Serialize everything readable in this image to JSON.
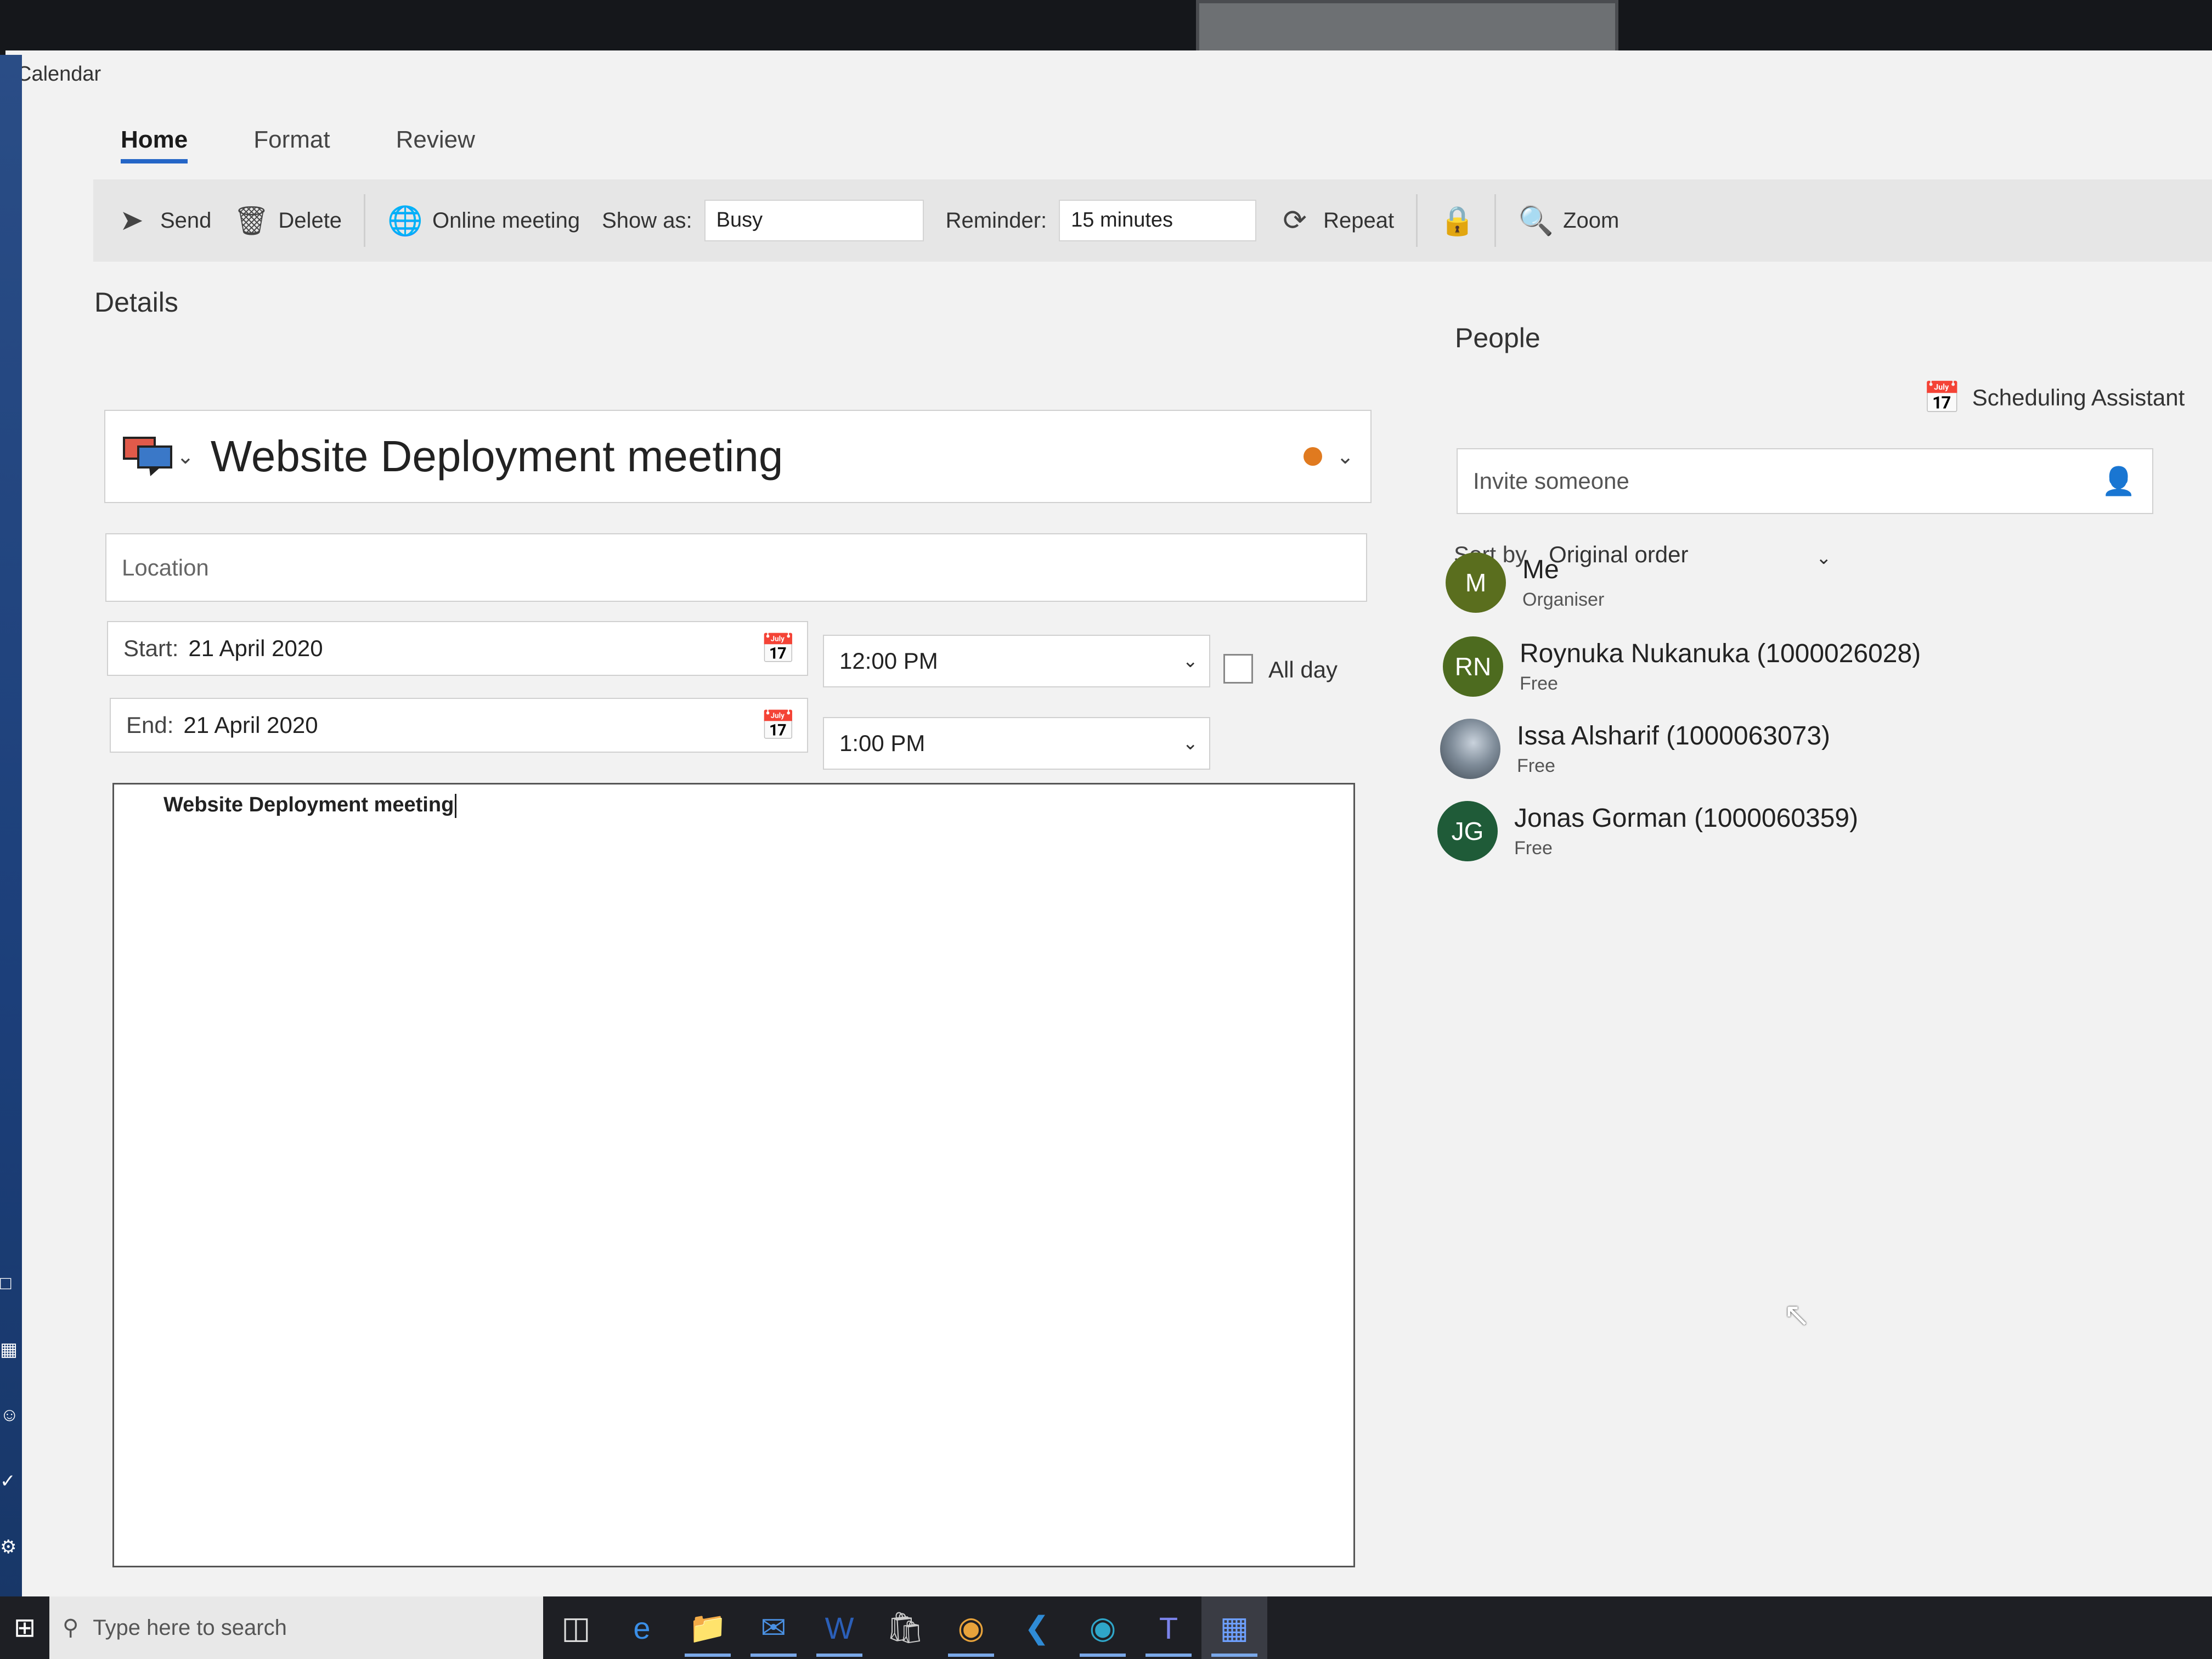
{
  "app": {
    "title": "Calendar"
  },
  "tabs": [
    {
      "label": "Home",
      "active": true
    },
    {
      "label": "Format",
      "active": false
    },
    {
      "label": "Review",
      "active": false
    }
  ],
  "toolbar": {
    "send_label": "Send",
    "delete_label": "Delete",
    "online_meeting_label": "Online meeting",
    "show_as_label": "Show as:",
    "show_as_value": "Busy",
    "reminder_label": "Reminder:",
    "reminder_value": "15 minutes",
    "repeat_label": "Repeat",
    "zoom_label": "Zoom"
  },
  "details": {
    "section_title": "Details",
    "subject": "Website Deployment meeting",
    "location_placeholder": "Location",
    "start_label": "Start:",
    "start_date": "21 April 2020",
    "start_time": "12:00 PM",
    "end_label": "End:",
    "end_date": "21 April 2020",
    "end_time": "1:00 PM",
    "all_day_label": "All day",
    "all_day_checked": false,
    "body_text": "Website Deployment meeting",
    "status_color": "#e07a1f"
  },
  "people": {
    "section_title": "People",
    "scheduling_assistant_label": "Scheduling Assistant",
    "invite_placeholder": "Invite someone",
    "sort_by_label": "Sort by",
    "sort_by_value": "Original order",
    "attendees": [
      {
        "initials": "M",
        "name": "Me",
        "status": "Organiser",
        "color": "#5a6e1e"
      },
      {
        "initials": "RN",
        "name": "Roynuka Nukanuka (1000026028)",
        "status": "Free",
        "color": "#4d6b1f"
      },
      {
        "initials": "",
        "name": "Issa Alsharif (1000063073)",
        "status": "Free",
        "color": "#6c7a8a"
      },
      {
        "initials": "JG",
        "name": "Jonas Gorman (1000060359)",
        "status": "Free",
        "color": "#1f5b38"
      }
    ]
  },
  "taskbar": {
    "search_placeholder": "Type here to search",
    "apps": [
      "task-view",
      "edge",
      "file-explorer",
      "mail",
      "word",
      "store",
      "chrome",
      "vscode",
      "edge-dev",
      "teams",
      "calendar"
    ]
  }
}
